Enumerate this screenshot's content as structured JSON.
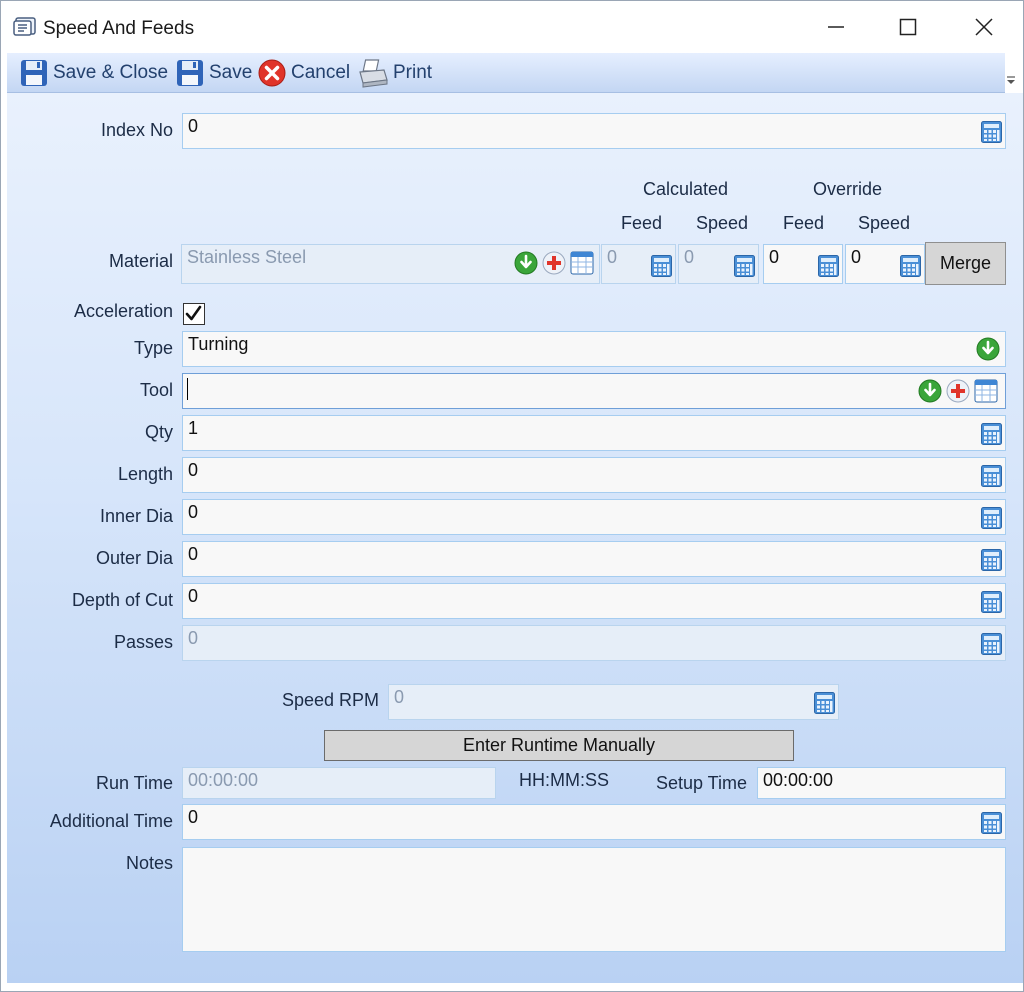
{
  "window": {
    "title": "Speed And Feeds",
    "icons": {
      "app": "form-window-icon",
      "minimize": "minimize-icon",
      "maximize": "maximize-icon",
      "close": "close-icon"
    }
  },
  "toolbar": {
    "save_close_label": "Save & Close",
    "save_label": "Save",
    "cancel_label": "Cancel",
    "print_label": "Print",
    "icons": {
      "save_close": "floppy-disk-icon",
      "save": "floppy-disk-icon",
      "cancel": "cancel-x-icon",
      "print": "printer-icon",
      "overflow": "overflow-chevron-icon"
    }
  },
  "form": {
    "index_no": {
      "label": "Index No",
      "value": "0"
    },
    "headers": {
      "calculated": "Calculated",
      "override": "Override",
      "feed": "Feed",
      "speed": "Speed"
    },
    "material": {
      "label": "Material",
      "value": "Stainless Steel",
      "calc_feed": "0",
      "calc_speed": "0",
      "override_feed": "0",
      "override_speed": "0",
      "merge_label": "Merge"
    },
    "acceleration": {
      "label": "Acceleration",
      "checked": true
    },
    "type": {
      "label": "Type",
      "value": "Turning"
    },
    "tool": {
      "label": "Tool",
      "value": ""
    },
    "qty": {
      "label": "Qty",
      "value": "1"
    },
    "length": {
      "label": "Length",
      "value": "0"
    },
    "inner_dia": {
      "label": "Inner Dia",
      "value": "0"
    },
    "outer_dia": {
      "label": "Outer Dia",
      "value": "0"
    },
    "depth_of_cut": {
      "label": "Depth of Cut",
      "value": "0"
    },
    "passes": {
      "label": "Passes",
      "value": "0"
    },
    "speed_rpm": {
      "label": "Speed RPM",
      "value": "0"
    },
    "enter_runtime_label": "Enter Runtime Manually",
    "run_time": {
      "label": "Run Time",
      "value": "00:00:00"
    },
    "time_format": "HH:MM:SS",
    "setup_time": {
      "label": "Setup Time",
      "value": "00:00:00"
    },
    "additional_time": {
      "label": "Additional Time",
      "value": "0"
    },
    "notes": {
      "label": "Notes",
      "value": ""
    }
  },
  "colors": {
    "accent_blue": "#a6cdf0",
    "toolbar_text": "#23416e",
    "green_icon": "#3aa53a",
    "red_icon": "#e0342a"
  }
}
